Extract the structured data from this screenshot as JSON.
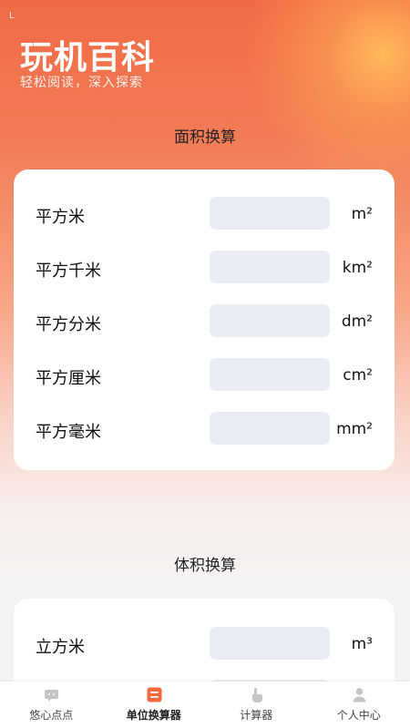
{
  "header": {
    "status_indicator": "L",
    "app_title": "玩机百科",
    "app_subtitle": "轻松阅读，深入探索"
  },
  "area_section": {
    "title": "面积换算",
    "rows": [
      {
        "label": "平方米",
        "unit": "m²",
        "value": ""
      },
      {
        "label": "平方千米",
        "unit": "km²",
        "value": ""
      },
      {
        "label": "平方分米",
        "unit": "dm²",
        "value": ""
      },
      {
        "label": "平方厘米",
        "unit": "cm²",
        "value": ""
      },
      {
        "label": "平方毫米",
        "unit": "mm²",
        "value": ""
      }
    ]
  },
  "volume_section": {
    "title": "体积换算",
    "rows": [
      {
        "label": "立方米",
        "unit": "m³",
        "value": ""
      }
    ]
  },
  "tabbar": {
    "active_index": 1,
    "accent_color": "#f26a3e",
    "inactive_icon_color": "#c4c4c4",
    "items": [
      {
        "label": "悠心点点",
        "icon": "chat-bubble-icon"
      },
      {
        "label": "单位换算器",
        "icon": "list-document-icon"
      },
      {
        "label": "计算器",
        "icon": "tap-hand-icon"
      },
      {
        "label": "个人中心",
        "icon": "person-icon"
      }
    ]
  }
}
